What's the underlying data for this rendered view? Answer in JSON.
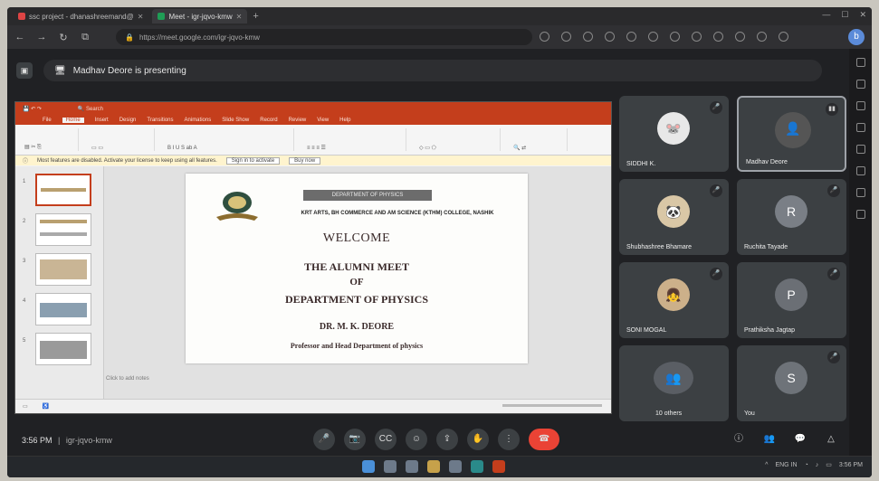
{
  "browser": {
    "tabs": [
      {
        "label": "ssc project - dhanashreemand@",
        "active": false
      },
      {
        "label": "Meet - igr-jqvo-kmw",
        "active": true
      }
    ],
    "url": "https://meet.google.com/igr-jqvo-kmw"
  },
  "meet": {
    "presenting_banner": "Madhav Deore is presenting",
    "time": "3:56 PM",
    "meeting_code": "igr-jqvo-kmw",
    "participants": [
      {
        "name": "SIDDHI K.",
        "initial": "",
        "speaking": false
      },
      {
        "name": "Madhav Deore",
        "initial": "",
        "speaking": true
      },
      {
        "name": "Shubhashree Bhamare",
        "initial": "",
        "speaking": false
      },
      {
        "name": "Ruchita Tayade",
        "initial": "R",
        "speaking": false
      },
      {
        "name": "SONI MOGAL",
        "initial": "",
        "speaking": false
      },
      {
        "name": "Prathiksha Jagtap",
        "initial": "P",
        "speaking": false
      },
      {
        "name": "10 others",
        "initial": "",
        "speaking": false
      },
      {
        "name": "You",
        "initial": "S",
        "speaking": false
      }
    ]
  },
  "ppt": {
    "menu": [
      "File",
      "Home",
      "Insert",
      "Design",
      "Transitions",
      "Animations",
      "Slide Show",
      "Record",
      "Review",
      "View",
      "Help"
    ],
    "warning": "Most features are disabled. Activate your license to keep using all features.",
    "warning_btn1": "Sign in to activate",
    "warning_btn2": "Buy now",
    "notes": "Click to add notes",
    "slide": {
      "header": "DEPARTMENT OF PHYSICS",
      "college": "KRT ARTS, BH COMMERCE AND AM SCIENCE (KTHM) COLLEGE, NASHIK",
      "welcome": "WELCOME",
      "line1": "THE ALUMNI MEET",
      "line2": "OF",
      "line3": "DEPARTMENT  OF PHYSICS",
      "presenter": "DR. M. K. DEORE",
      "designation": "Professor and Head Department of physics"
    }
  },
  "taskbar": {
    "lang": "ENG IN",
    "time": "3:56 PM"
  }
}
